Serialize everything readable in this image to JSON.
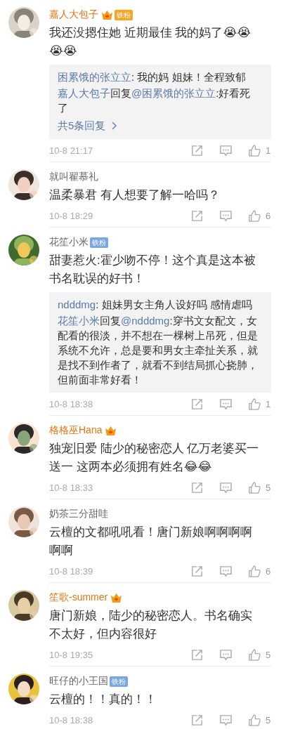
{
  "comments": [
    {
      "name": "嘉人大包子",
      "vip": true,
      "fan_badge": {
        "text": "铁粉",
        "color": "#f5a623"
      },
      "text": "我还没摁住她  近期最佳 我的妈了😭😭😭😭",
      "replies": [
        {
          "author": "困累饿的张立立",
          "text": ": 我的妈 姐妹！全程致郁"
        },
        {
          "author": "嘉人大包子",
          "verb": "回复",
          "mention": "@困累饿的张立立",
          "text": ":好看死了"
        }
      ],
      "more": "共5条回复",
      "time": "10-8 21:17",
      "likes": "1"
    },
    {
      "name": "就叫翟慕礼",
      "vip": false,
      "text": "温柔暴君 有人想要了解一哈吗？",
      "time": "10-8 18:29",
      "likes": "6"
    },
    {
      "name": "花笙小米",
      "vip": false,
      "fan_badge": {
        "text": "铁粉",
        "color": "#79a8e0"
      },
      "text": "甜妻惹火:霍少吻不停！这个真是这本被书名耽误的好书！",
      "replies": [
        {
          "author": "ndddmg",
          "text": ": 姐妹男女主角人设好吗 感情虐吗"
        },
        {
          "author": "花笙小米",
          "verb": "回复",
          "mention": "@ndddmg",
          "text": ":穿书文女配文，女配看的很淡，并不想在一棵树上吊死，但是系统不允许，总是要和男女主牵扯关系，就是找不到作者了，就看不到结局抓心挠肺，但前面非常好看！"
        }
      ],
      "time": "10-8 18:38",
      "likes": "1"
    },
    {
      "name": "格格巫Hana",
      "vip": true,
      "text": "独宠旧爱 陆少的秘密恋人 亿万老婆买一送一 这两本必须拥有姓名😂😂",
      "time": "10-8 18:33",
      "likes": "5"
    },
    {
      "name": "奶茶三分甜哇",
      "vip": false,
      "text": "云檀的文都吼吼看！唐门新娘啊啊啊啊啊啊",
      "time": "10-8 18:39",
      "likes": "6"
    },
    {
      "name": "笙歌-summer",
      "vip": true,
      "text": "唐门新娘，陆少的秘密恋人。书名确实不太好，但内容很好",
      "time": "10-8 19:35",
      "likes": "5"
    },
    {
      "name": "旺仔的小王国",
      "vip": false,
      "fan_badge": {
        "text": "铁粉",
        "color": "#79a8e0"
      },
      "text": "云檀的！！真的！！",
      "time": "10-8 18:38",
      "likes": "5"
    }
  ]
}
